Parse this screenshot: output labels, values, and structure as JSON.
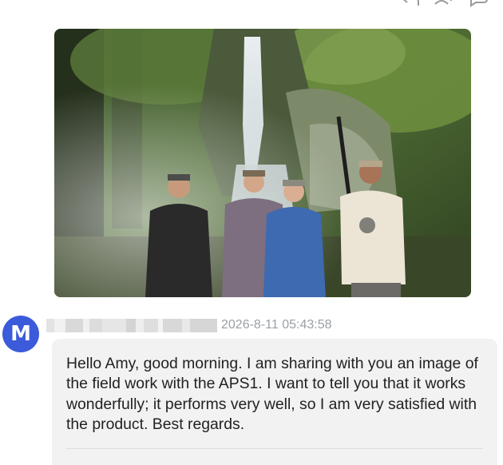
{
  "toolbar": {
    "icons": [
      "reply-icon",
      "add-contact-icon",
      "more-icon"
    ]
  },
  "attachment": {
    "type": "photo",
    "subject": "four men standing in front of a forest waterfall"
  },
  "message": {
    "avatar_initial": "M",
    "sender_name": "",
    "timestamp": "2026-8-11 05:43:58",
    "body": "Hello Amy, good morning. I am sharing with you an image of the field work with the APS1. I want to tell you that it works wonderfully; it performs very well, so I am very satisfied with the product. Best regards."
  },
  "colors": {
    "avatar": "#3b5bdb",
    "bubble": "#f2f2f2",
    "timestamp": "#9aa0a6",
    "text": "#222222"
  }
}
